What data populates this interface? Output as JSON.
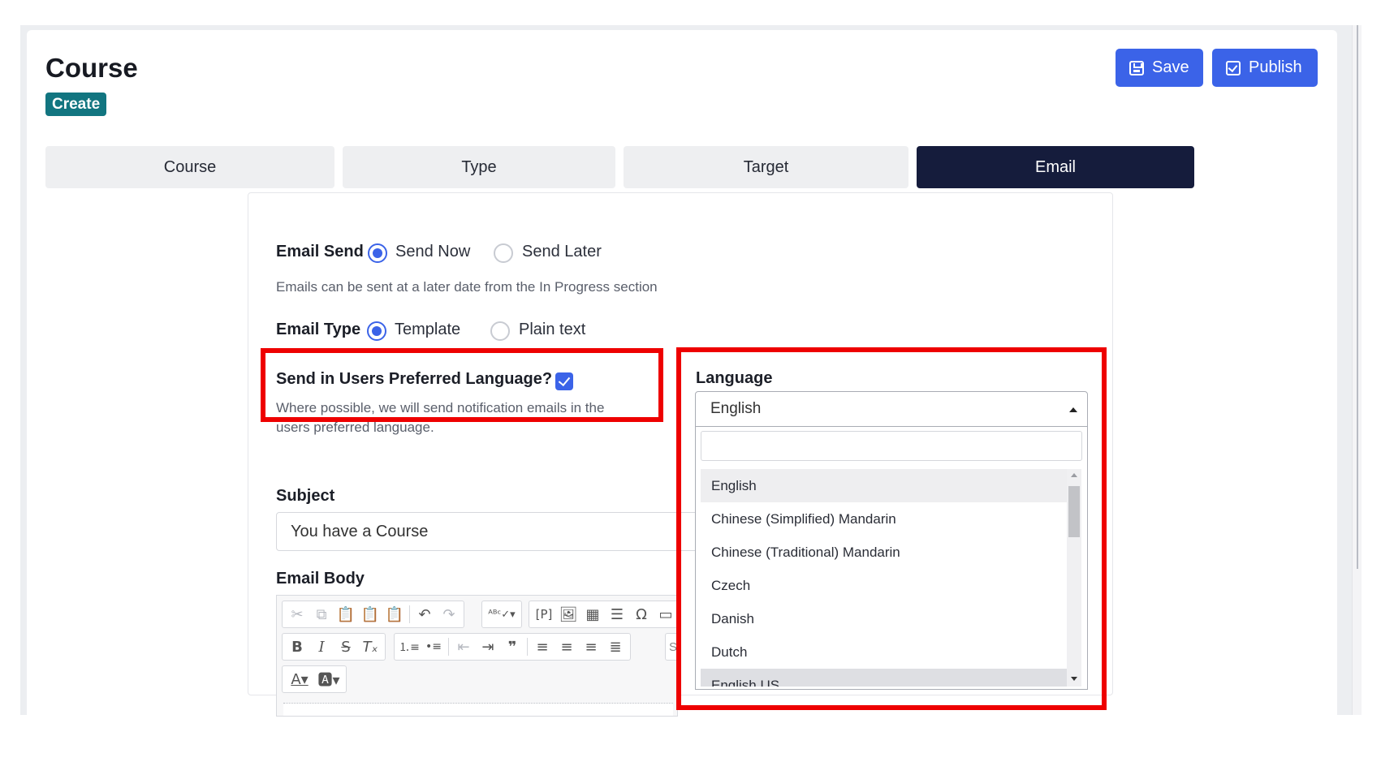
{
  "header": {
    "title": "Course",
    "badge": "Create",
    "save_label": "Save",
    "publish_label": "Publish"
  },
  "tabs": [
    {
      "label": "Course",
      "active": false
    },
    {
      "label": "Type",
      "active": false
    },
    {
      "label": "Target",
      "active": false
    },
    {
      "label": "Email",
      "active": true
    }
  ],
  "email_send": {
    "label": "Email Send",
    "options": [
      "Send Now",
      "Send Later"
    ],
    "selected": "Send Now",
    "help": "Emails can be sent at a later date from the In Progress section"
  },
  "email_type": {
    "label": "Email Type",
    "options": [
      "Template",
      "Plain text"
    ],
    "selected": "Template"
  },
  "preferred_language": {
    "label": "Send in Users Preferred Language?",
    "checked": true,
    "help_line1": "Where possible, we will send notification emails in the",
    "help_line2": "users preferred language."
  },
  "subject": {
    "label": "Subject",
    "value": "You have a Course"
  },
  "email_body": {
    "label": "Email Body",
    "style_partial": "Sty"
  },
  "language": {
    "label": "Language",
    "selected": "English",
    "search_value": "",
    "options": [
      "English",
      "Chinese (Simplified) Mandarin",
      "Chinese (Traditional) Mandarin",
      "Czech",
      "Danish",
      "Dutch",
      "English US"
    ]
  },
  "colors": {
    "primary": "#3b63e8",
    "active_tab": "#151c3c",
    "badge": "#127580",
    "highlight": "#ee0000"
  }
}
